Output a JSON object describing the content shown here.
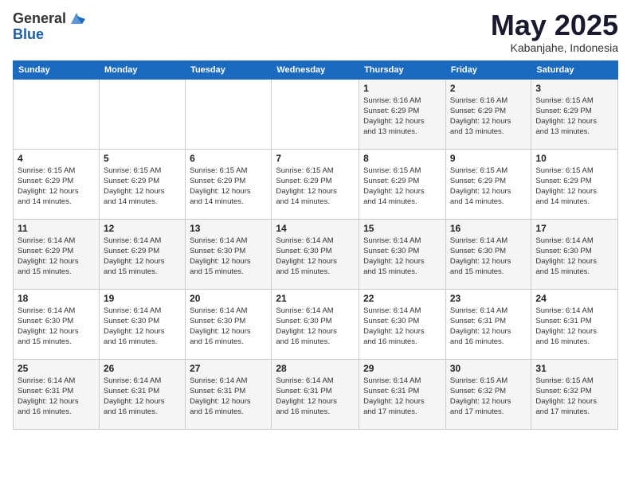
{
  "logo": {
    "general": "General",
    "blue": "Blue"
  },
  "title": {
    "month": "May 2025",
    "location": "Kabanjahe, Indonesia"
  },
  "weekdays": [
    "Sunday",
    "Monday",
    "Tuesday",
    "Wednesday",
    "Thursday",
    "Friday",
    "Saturday"
  ],
  "weeks": [
    [
      {
        "day": "",
        "info": ""
      },
      {
        "day": "",
        "info": ""
      },
      {
        "day": "",
        "info": ""
      },
      {
        "day": "",
        "info": ""
      },
      {
        "day": "1",
        "info": "Sunrise: 6:16 AM\nSunset: 6:29 PM\nDaylight: 12 hours\nand 13 minutes."
      },
      {
        "day": "2",
        "info": "Sunrise: 6:16 AM\nSunset: 6:29 PM\nDaylight: 12 hours\nand 13 minutes."
      },
      {
        "day": "3",
        "info": "Sunrise: 6:15 AM\nSunset: 6:29 PM\nDaylight: 12 hours\nand 13 minutes."
      }
    ],
    [
      {
        "day": "4",
        "info": "Sunrise: 6:15 AM\nSunset: 6:29 PM\nDaylight: 12 hours\nand 14 minutes."
      },
      {
        "day": "5",
        "info": "Sunrise: 6:15 AM\nSunset: 6:29 PM\nDaylight: 12 hours\nand 14 minutes."
      },
      {
        "day": "6",
        "info": "Sunrise: 6:15 AM\nSunset: 6:29 PM\nDaylight: 12 hours\nand 14 minutes."
      },
      {
        "day": "7",
        "info": "Sunrise: 6:15 AM\nSunset: 6:29 PM\nDaylight: 12 hours\nand 14 minutes."
      },
      {
        "day": "8",
        "info": "Sunrise: 6:15 AM\nSunset: 6:29 PM\nDaylight: 12 hours\nand 14 minutes."
      },
      {
        "day": "9",
        "info": "Sunrise: 6:15 AM\nSunset: 6:29 PM\nDaylight: 12 hours\nand 14 minutes."
      },
      {
        "day": "10",
        "info": "Sunrise: 6:15 AM\nSunset: 6:29 PM\nDaylight: 12 hours\nand 14 minutes."
      }
    ],
    [
      {
        "day": "11",
        "info": "Sunrise: 6:14 AM\nSunset: 6:29 PM\nDaylight: 12 hours\nand 15 minutes."
      },
      {
        "day": "12",
        "info": "Sunrise: 6:14 AM\nSunset: 6:29 PM\nDaylight: 12 hours\nand 15 minutes."
      },
      {
        "day": "13",
        "info": "Sunrise: 6:14 AM\nSunset: 6:30 PM\nDaylight: 12 hours\nand 15 minutes."
      },
      {
        "day": "14",
        "info": "Sunrise: 6:14 AM\nSunset: 6:30 PM\nDaylight: 12 hours\nand 15 minutes."
      },
      {
        "day": "15",
        "info": "Sunrise: 6:14 AM\nSunset: 6:30 PM\nDaylight: 12 hours\nand 15 minutes."
      },
      {
        "day": "16",
        "info": "Sunrise: 6:14 AM\nSunset: 6:30 PM\nDaylight: 12 hours\nand 15 minutes."
      },
      {
        "day": "17",
        "info": "Sunrise: 6:14 AM\nSunset: 6:30 PM\nDaylight: 12 hours\nand 15 minutes."
      }
    ],
    [
      {
        "day": "18",
        "info": "Sunrise: 6:14 AM\nSunset: 6:30 PM\nDaylight: 12 hours\nand 15 minutes."
      },
      {
        "day": "19",
        "info": "Sunrise: 6:14 AM\nSunset: 6:30 PM\nDaylight: 12 hours\nand 16 minutes."
      },
      {
        "day": "20",
        "info": "Sunrise: 6:14 AM\nSunset: 6:30 PM\nDaylight: 12 hours\nand 16 minutes."
      },
      {
        "day": "21",
        "info": "Sunrise: 6:14 AM\nSunset: 6:30 PM\nDaylight: 12 hours\nand 16 minutes."
      },
      {
        "day": "22",
        "info": "Sunrise: 6:14 AM\nSunset: 6:30 PM\nDaylight: 12 hours\nand 16 minutes."
      },
      {
        "day": "23",
        "info": "Sunrise: 6:14 AM\nSunset: 6:31 PM\nDaylight: 12 hours\nand 16 minutes."
      },
      {
        "day": "24",
        "info": "Sunrise: 6:14 AM\nSunset: 6:31 PM\nDaylight: 12 hours\nand 16 minutes."
      }
    ],
    [
      {
        "day": "25",
        "info": "Sunrise: 6:14 AM\nSunset: 6:31 PM\nDaylight: 12 hours\nand 16 minutes."
      },
      {
        "day": "26",
        "info": "Sunrise: 6:14 AM\nSunset: 6:31 PM\nDaylight: 12 hours\nand 16 minutes."
      },
      {
        "day": "27",
        "info": "Sunrise: 6:14 AM\nSunset: 6:31 PM\nDaylight: 12 hours\nand 16 minutes."
      },
      {
        "day": "28",
        "info": "Sunrise: 6:14 AM\nSunset: 6:31 PM\nDaylight: 12 hours\nand 16 minutes."
      },
      {
        "day": "29",
        "info": "Sunrise: 6:14 AM\nSunset: 6:31 PM\nDaylight: 12 hours\nand 17 minutes."
      },
      {
        "day": "30",
        "info": "Sunrise: 6:15 AM\nSunset: 6:32 PM\nDaylight: 12 hours\nand 17 minutes."
      },
      {
        "day": "31",
        "info": "Sunrise: 6:15 AM\nSunset: 6:32 PM\nDaylight: 12 hours\nand 17 minutes."
      }
    ]
  ]
}
